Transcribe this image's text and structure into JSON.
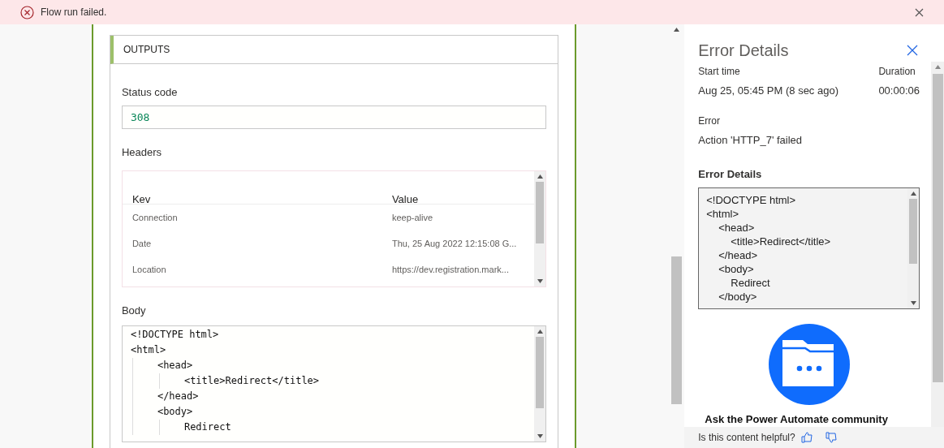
{
  "banner": {
    "message": "Flow run failed."
  },
  "outputs": {
    "title": "OUTPUTS",
    "status_label": "Status code",
    "status_value": "308",
    "headers_label": "Headers",
    "headers": {
      "columns": [
        "Kev",
        "Value"
      ],
      "rows": [
        {
          "key": "Connection",
          "value": "keep-alive"
        },
        {
          "key": "Date",
          "value": "Thu, 25 Aug 2022 12:15:08 G..."
        },
        {
          "key": "Location",
          "value": "https://dev.registration.mark..."
        }
      ]
    },
    "body_label": "Body",
    "body_lines": [
      {
        "text": "<!DOCTYPE html>"
      },
      {
        "text": "<html>",
        "children": [
          {
            "text": "<head>",
            "children": [
              {
                "text": "<title>Redirect</title>"
              }
            ]
          },
          {
            "text": "</head>"
          },
          {
            "text": "<body>",
            "children": [
              {
                "text": "Redirect"
              }
            ]
          }
        ]
      }
    ]
  },
  "panel": {
    "title": "Error Details",
    "start_label": "Start time",
    "start_value": "Aug 25, 05:45 PM (8 sec ago)",
    "duration_label": "Duration",
    "duration_value": "00:00:06",
    "error_label": "Error",
    "error_value": "Action 'HTTP_7' failed",
    "details_heading": "Error Details",
    "details_lines": [
      {
        "text": "<!DOCTYPE html>"
      },
      {
        "text": "<html>",
        "children": [
          {
            "text": "<head>",
            "children": [
              {
                "text": "<title>Redirect</title>"
              }
            ]
          },
          {
            "text": "</head>"
          },
          {
            "text": "<body>",
            "children": [
              {
                "text": "Redirect"
              }
            ]
          },
          {
            "text": "</body>"
          }
        ]
      }
    ],
    "community": "Ask the Power Automate community",
    "feedback": "Is this content helpful?"
  }
}
